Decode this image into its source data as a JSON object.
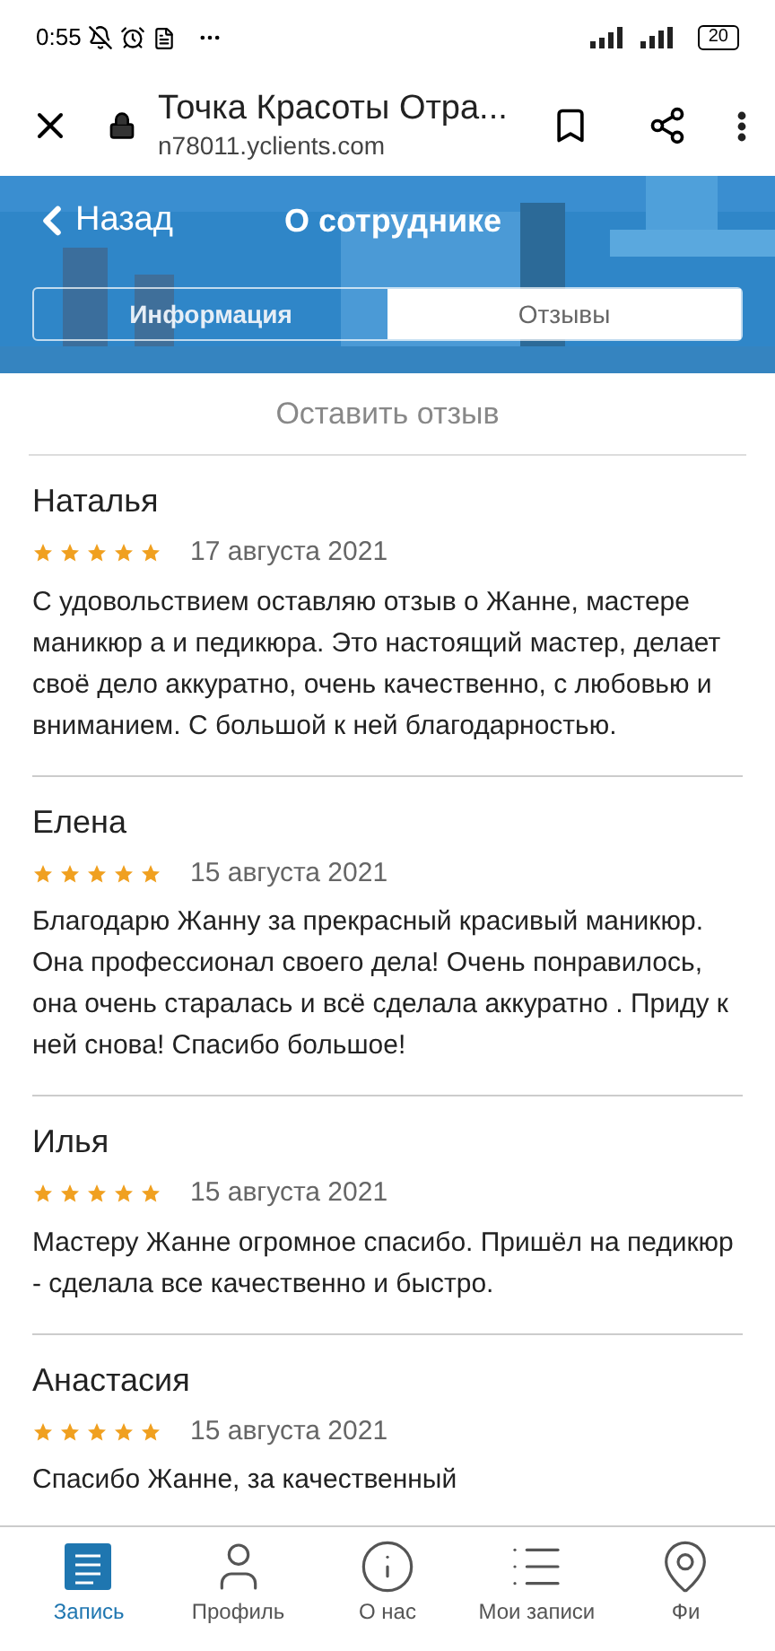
{
  "status_bar": {
    "time": "0:55",
    "battery": "20"
  },
  "browser": {
    "title": "Точка Красоты Отра...",
    "url": "n78011.yclients.com"
  },
  "header": {
    "back": "Назад",
    "title": "О сотруднике"
  },
  "tabs": [
    {
      "label": "Информация",
      "selected": false
    },
    {
      "label": "Отзывы",
      "selected": true
    }
  ],
  "leave_review": "Оставить отзыв",
  "reviews": [
    {
      "name": "Наталья",
      "stars": 5,
      "date": "17 августа 2021",
      "text": "С удовольствием оставляю отзыв о Жанне, мастере маникюр а и педикюра. Это настоящий мастер, делает своё дело аккуратно, очень качественно, с любовью и вниманием. С большой к ней благодарностью."
    },
    {
      "name": "Елена",
      "stars": 5,
      "date": "15 августа 2021",
      "text": "Благодарю Жанну за прекрасный красивый маникюр. Она профессионал своего дела! Очень понравилось, она очень старалась и всё сделала аккуратно . Приду к ней снова! Спасибо большое!"
    },
    {
      "name": "Илья",
      "stars": 5,
      "date": "15 августа 2021",
      "text": "Мастеру Жанне огромное спасибо. Пришёл на педикюр - сделала все качественно и быстро."
    },
    {
      "name": "Анастасия",
      "stars": 5,
      "date": "15 августа 2021",
      "text": "Спасибо Жанне, за качественный"
    }
  ],
  "bottom_nav": [
    {
      "label": "Запись",
      "kind": "booking",
      "selected": true
    },
    {
      "label": "Профиль",
      "kind": "profile",
      "selected": false
    },
    {
      "label": "О нас",
      "kind": "info",
      "selected": false
    },
    {
      "label": "Мои записи",
      "kind": "list",
      "selected": false
    },
    {
      "label": "Фи",
      "kind": "pin",
      "selected": false
    }
  ]
}
